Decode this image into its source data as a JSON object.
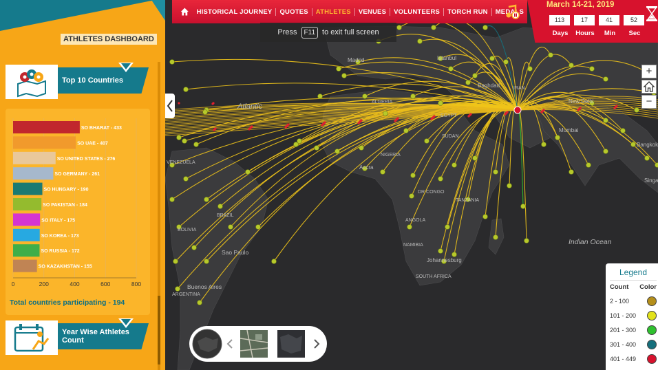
{
  "nav": {
    "items": [
      {
        "label": "HISTORICAL JOURNEY",
        "active": false
      },
      {
        "label": "QUOTES",
        "active": false
      },
      {
        "label": "ATHLETES",
        "active": true
      },
      {
        "label": "VENUES",
        "active": false
      },
      {
        "label": "VOLUNTEERS",
        "active": false
      },
      {
        "label": "TORCH RUN",
        "active": false
      },
      {
        "label": "MEDALS",
        "active": false
      }
    ],
    "home_icon": "home-icon",
    "active_color": "#ffb830",
    "brand_color": "#d7122d"
  },
  "countdown": {
    "date": "March 14-21, 2019",
    "values": [
      "113",
      "17",
      "41",
      "52"
    ],
    "labels": [
      "Days",
      "Hours",
      "Min",
      "Sec"
    ]
  },
  "panel": {
    "title": "ATHLETES DASHBOARD",
    "top_countries": {
      "label": "Top 10 Countries",
      "total": "Total countries participating - 194"
    },
    "year_wise": {
      "label": "Year Wise Athletes Count"
    }
  },
  "fullscreen_hint": {
    "prefix": "Press",
    "key": "F11",
    "suffix": "to exit full screen"
  },
  "zoom": {
    "in": "+",
    "home_icon": "home-icon",
    "out": "−"
  },
  "legend": {
    "title": "Legend",
    "count_header": "Count",
    "color_header": "Color",
    "rows": [
      {
        "range": "2 - 100",
        "color": "#b58f1a"
      },
      {
        "range": "101 - 200",
        "color": "#e2e21a"
      },
      {
        "range": "201 - 300",
        "color": "#2fc12f"
      },
      {
        "range": "301 - 400",
        "color": "#156f7c"
      },
      {
        "range": "401 - 449",
        "color": "#d7122d"
      }
    ]
  },
  "map_labels": [
    {
      "text": "Atlantic",
      "id": "atlantic"
    },
    {
      "text": "Indian Ocean",
      "id": "indian-ocean"
    },
    {
      "text": "Sao Paulo",
      "id": "sao-paulo"
    },
    {
      "text": "Buenos Aires",
      "id": "buenos-aires"
    },
    {
      "text": "ARGENTINA",
      "id": "argentina"
    },
    {
      "text": "BOLIVIA",
      "id": "bolivia"
    },
    {
      "text": "BRAZIL",
      "id": "brazil"
    },
    {
      "text": "VENEZUELA",
      "id": "venezuela"
    },
    {
      "text": "Madrid",
      "id": "madrid"
    },
    {
      "text": "Istanbul",
      "id": "istanbul"
    },
    {
      "text": "Baghdad",
      "id": "baghdad"
    },
    {
      "text": "IRAN",
      "id": "iran"
    },
    {
      "text": "Mumbai",
      "id": "mumbai"
    },
    {
      "text": "New Delhi",
      "id": "new-delhi"
    },
    {
      "text": "Bangkok",
      "id": "bangkok"
    },
    {
      "text": "NIGERIA",
      "id": "nigeria"
    },
    {
      "text": "SUDAN",
      "id": "sudan"
    },
    {
      "text": "DR CONGO",
      "id": "dr-congo"
    },
    {
      "text": "TANZANIA",
      "id": "tanzania"
    },
    {
      "text": "ANGOLA",
      "id": "angola"
    },
    {
      "text": "NAMIBIA",
      "id": "namibia"
    },
    {
      "text": "SOUTH AFRICA",
      "id": "south-africa"
    },
    {
      "text": "Johannesburg",
      "id": "johannesburg"
    },
    {
      "text": "Accra",
      "id": "accra"
    },
    {
      "text": "ALGERIA",
      "id": "algeria"
    },
    {
      "text": "EGYPT",
      "id": "egypt"
    },
    {
      "text": "Singa",
      "id": "singapore"
    }
  ],
  "chart_data": {
    "type": "bar",
    "orientation": "horizontal",
    "categories": [
      "SO BHARAT",
      "SO UAE",
      "SO UNITED STATES",
      "SO GERMANY",
      "SO HUNGARY",
      "SO PAKISTAN",
      "SO ITALY",
      "SO KOREA",
      "SO RUSSIA",
      "SO KAZAKHSTAN"
    ],
    "values": [
      433,
      407,
      276,
      261,
      190,
      184,
      175,
      173,
      172,
      155
    ],
    "bar_labels": [
      "SO BHARAT - 433",
      "SO UAE - 407",
      "SO UNITED STATES - 276",
      "SO GERMANY - 261",
      "SO HUNGARY - 190",
      "SO PAKISTAN - 184",
      "SO ITALY - 175",
      "SO KOREA - 173",
      "SO RUSSIA - 172",
      "SO KAZAKHSTAN - 155"
    ],
    "colors": [
      "#c1272d",
      "#f19a2c",
      "#e9c89a",
      "#a6b8cc",
      "#1b7a72",
      "#94bb2e",
      "#d535d1",
      "#27a9e1",
      "#3fae49",
      "#c08454"
    ],
    "xlim": [
      0,
      800
    ],
    "xticks": [
      "0",
      "200",
      "400",
      "600",
      "800"
    ],
    "grid": true
  }
}
